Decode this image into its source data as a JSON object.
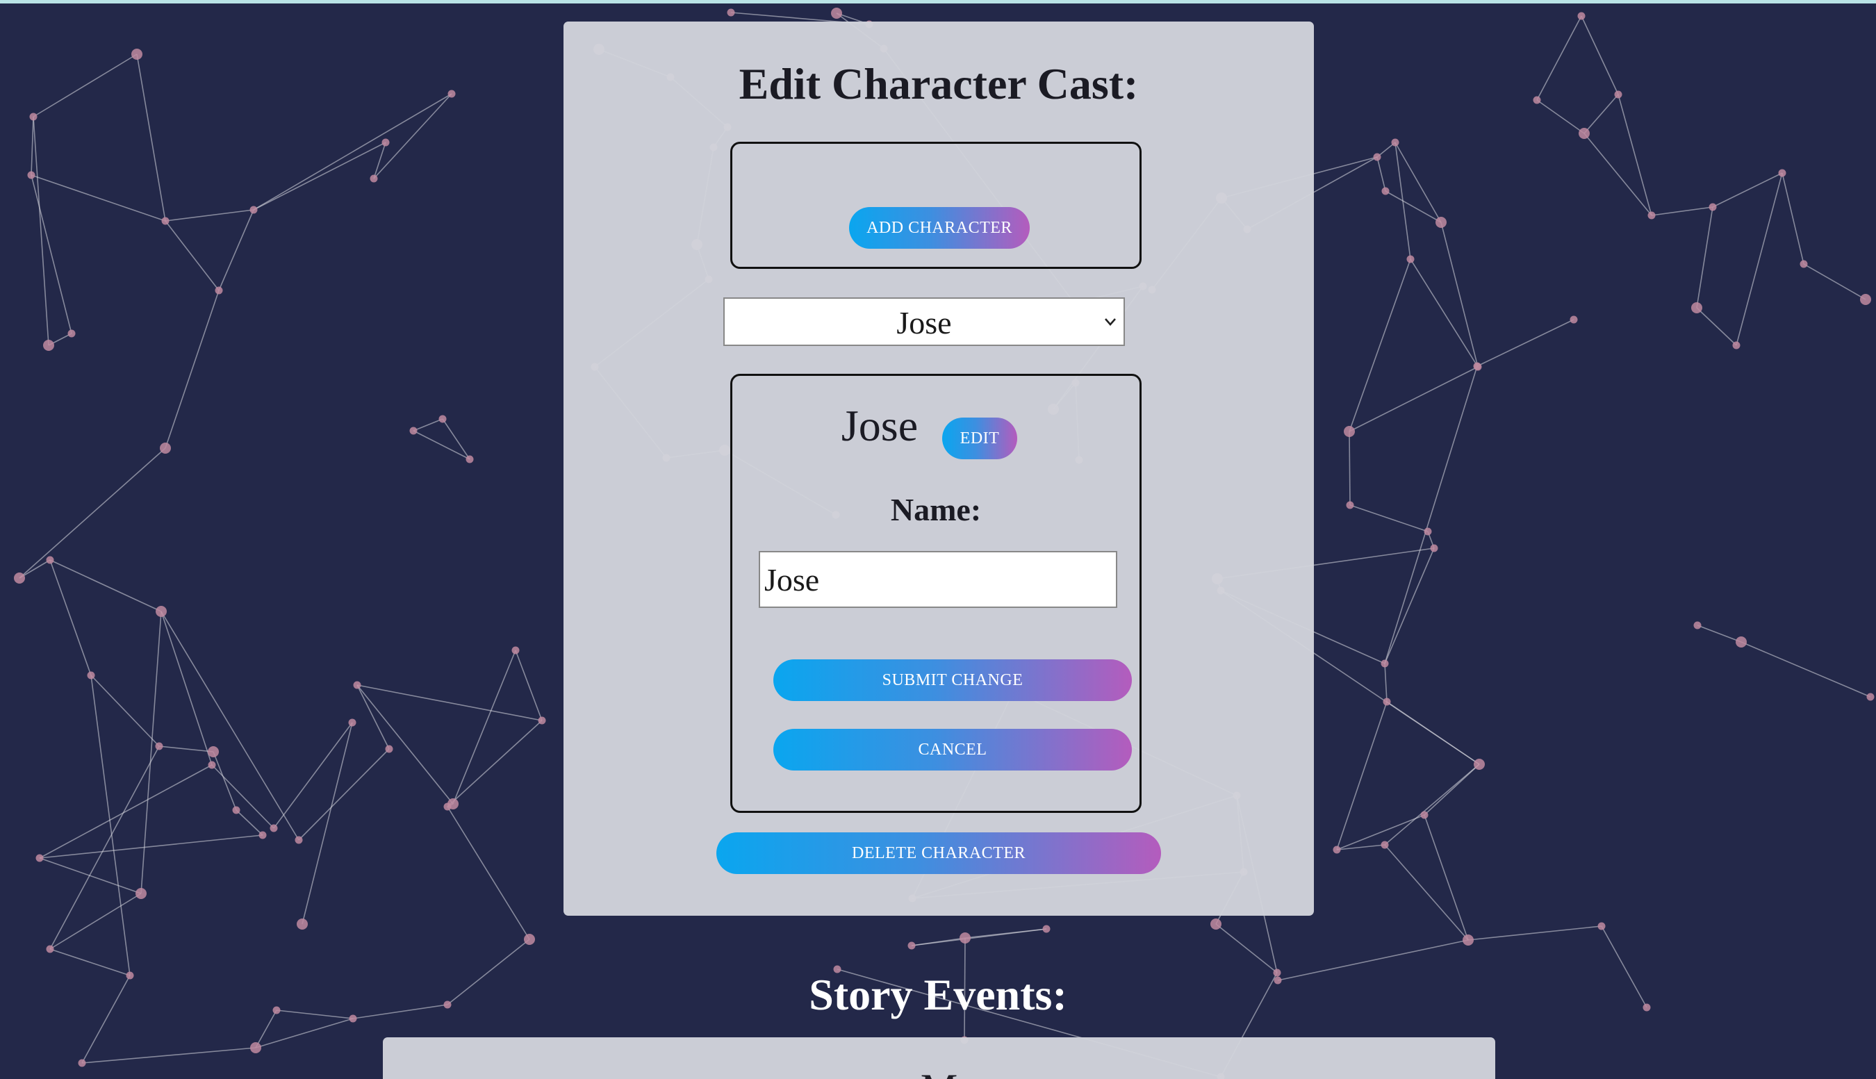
{
  "edit_panel": {
    "title": "Edit Character Cast:",
    "add_button": "ADD CHARACTER",
    "character_select": {
      "selected": "Jose"
    },
    "character": {
      "heading": "Jose",
      "edit_button": "EDIT",
      "name_label": "Name:",
      "name_value": "Jose",
      "submit_button": "SUBMIT CHANGE",
      "cancel_button": "CANCEL"
    },
    "delete_button": "DELETE CHARACTER"
  },
  "story": {
    "title": "Story Events:",
    "first_entry_partial": "M"
  },
  "colors": {
    "background": "#232849",
    "panel": "#d2d4dc",
    "button_gradient_start": "#0aa6ef",
    "button_gradient_end": "#b45cbd",
    "network_node": "#c08aa0",
    "network_line": "#d8d8e0"
  }
}
